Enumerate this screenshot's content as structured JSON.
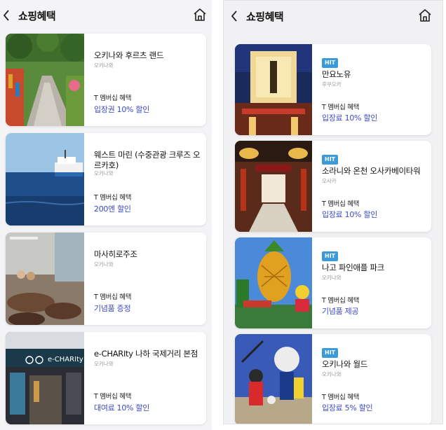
{
  "left_screen": {
    "header": {
      "title": "쇼핑혜택",
      "back_icon": "chevron-left-icon",
      "home_icon": "home-icon"
    },
    "cards": [
      {
        "name": "오키나와 후르츠 랜드",
        "location": "오키나와",
        "membership_label": "T 멤버십 혜택",
        "benefit": "입장권 10% 할인"
      },
      {
        "name": "웨스트 마린 (수중관광 크루즈 오르카호)",
        "location": "오키나와",
        "membership_label": "T 멤버십 혜택",
        "benefit": "200엔 할인"
      },
      {
        "name": "마사히로주조",
        "location": "오키나와",
        "membership_label": "T 멤버십 혜택",
        "benefit": "기념품 증정"
      },
      {
        "name": "e-CHARIty 나하 국제거리 본점",
        "location": "오키나와",
        "membership_label": "T 멤버십 혜택",
        "benefit": "대여료 10% 할인",
        "sign_text": "e-CHARIty"
      }
    ]
  },
  "right_screen": {
    "header": {
      "title": "쇼핑혜택",
      "back_icon": "chevron-left-icon",
      "home_icon": "home-icon"
    },
    "cards": [
      {
        "badge": "HIT",
        "name": "만요노유",
        "location": "후쿠오카",
        "membership_label": "T 멤버십 혜택",
        "benefit": "입장료 10% 할인"
      },
      {
        "badge": "HIT",
        "name": "소라니와 온천 오사카베이타워",
        "location": "오사카",
        "membership_label": "T 멤버십 혜택",
        "benefit": "입장료 10% 할인"
      },
      {
        "badge": "HIT",
        "name": "나고 파인애플 파크",
        "location": "오키나와",
        "membership_label": "T 멤버십 혜택",
        "benefit": "기념품 제공"
      },
      {
        "badge": "HIT",
        "name": "오키나와 월드",
        "location": "오키나와",
        "membership_label": "T 멤버십 혜택",
        "benefit": "입장료 5% 할인"
      }
    ]
  },
  "colors": {
    "benefit_text": "#3c49c8",
    "hit_badge": "#3a9bd8",
    "background": "#f4f4f6",
    "card": "#ffffff"
  }
}
